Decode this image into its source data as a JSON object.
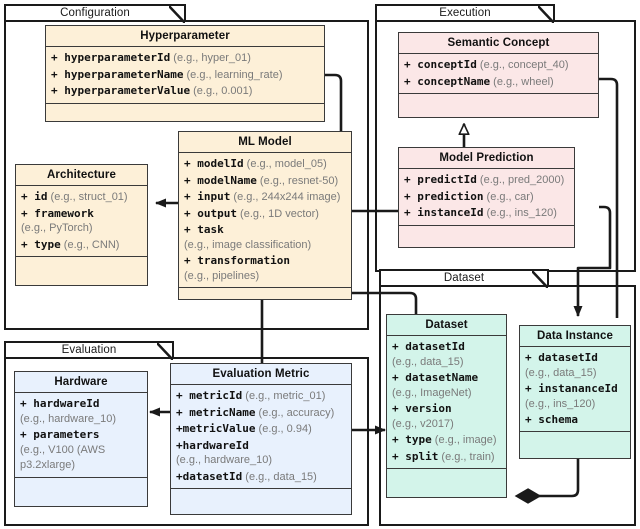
{
  "diagram": {
    "title": "ML Ontology Class Diagram",
    "colors": {
      "yellow": "#fdf0d8",
      "pink": "#fbe7e7",
      "cyan": "#d3f4ea",
      "blue": "#e8f1fd",
      "border": "#3a3a3a",
      "frame": "#1a1a1a"
    }
  },
  "packages": [
    {
      "id": "configuration",
      "label": "Configuration"
    },
    {
      "id": "execution",
      "label": "Execution"
    },
    {
      "id": "dataset",
      "label": "Dataset"
    },
    {
      "id": "evaluation",
      "label": "Evaluation"
    }
  ],
  "classes": {
    "hyperparameter": {
      "title": "Hyperparameter",
      "attributes": [
        {
          "vis": "+ ",
          "name": "hyperparameterId",
          "example": " (e.g., hyper_01)"
        },
        {
          "vis": "+ ",
          "name": "hyperparameterName",
          "example": " (e.g., learning_rate)"
        },
        {
          "vis": "+ ",
          "name": "hyperparameterValue",
          "example": " (e.g., 0.001)"
        }
      ]
    },
    "ml_model": {
      "title": "ML Model",
      "attributes": [
        {
          "vis": "+ ",
          "name": "modelId",
          "example": " (e.g., model_05)"
        },
        {
          "vis": "+ ",
          "name": "modelName",
          "example": " (e.g., resnet-50)"
        },
        {
          "vis": "+ ",
          "name": "input",
          "example": " (e.g., 244x244 image)"
        },
        {
          "vis": "+ ",
          "name": "output",
          "example": " (e.g., 1D vector)"
        },
        {
          "vis": "+ ",
          "name": "task",
          "example": ""
        },
        {
          "cont": "(e.g., image classification)"
        },
        {
          "vis": "+ ",
          "name": "transformation",
          "example": ""
        },
        {
          "cont": "(e.g., pipelines)"
        }
      ]
    },
    "architecture": {
      "title": "Architecture",
      "attributes": [
        {
          "vis": "+ ",
          "name": "id",
          "example": " (e.g., struct_01)"
        },
        {
          "vis": "+ ",
          "name": "framework",
          "example": ""
        },
        {
          "cont": "(e.g., PyTorch)"
        },
        {
          "vis": "+ ",
          "name": "type",
          "example": " (e.g., CNN)"
        }
      ]
    },
    "semantic_concept": {
      "title": "Semantic Concept",
      "attributes": [
        {
          "vis": "+ ",
          "name": "conceptId",
          "example": " (e.g., concept_40)"
        },
        {
          "vis": "+ ",
          "name": "conceptName",
          "example": " (e.g., wheel)"
        }
      ]
    },
    "model_prediction": {
      "title": "Model Prediction",
      "attributes": [
        {
          "vis": "+ ",
          "name": "predictId",
          "example": " (e.g., pred_2000)"
        },
        {
          "vis": "+ ",
          "name": "prediction",
          "example": " (e.g., car)"
        },
        {
          "vis": "+ ",
          "name": "instanceId",
          "example": " (e.g., ins_120)"
        }
      ]
    },
    "dataset": {
      "title": "Dataset",
      "attributes": [
        {
          "vis": "+ ",
          "name": "datasetId",
          "example": ""
        },
        {
          "cont": "(e.g., data_15)"
        },
        {
          "vis": "+ ",
          "name": "datasetName",
          "example": ""
        },
        {
          "cont": "(e.g., ImageNet)"
        },
        {
          "vis": "+ ",
          "name": "version",
          "example": ""
        },
        {
          "cont": "(e.g., v2017)"
        },
        {
          "vis": "+ ",
          "name": "type",
          "example": " (e.g., image)"
        },
        {
          "vis": "+ ",
          "name": "split",
          "example": " (e.g., train)"
        }
      ]
    },
    "data_instance": {
      "title": "Data Instance",
      "attributes": [
        {
          "vis": "+ ",
          "name": "datasetId",
          "example": ""
        },
        {
          "cont": "(e.g., data_15)"
        },
        {
          "vis": "+ ",
          "name": "instananceId",
          "example": ""
        },
        {
          "cont": "(e.g., ins_120)"
        },
        {
          "vis": "+ ",
          "name": "schema",
          "example": ""
        }
      ]
    },
    "hardware": {
      "title": "Hardware",
      "attributes": [
        {
          "vis": "+ ",
          "name": "hardwareId",
          "example": ""
        },
        {
          "cont": "(e.g., hardware_10)"
        },
        {
          "vis": "+ ",
          "name": "parameters",
          "example": ""
        },
        {
          "cont": "(e.g., V100 (AWS"
        },
        {
          "cont": "p3.2xlarge)"
        }
      ]
    },
    "evaluation_metric": {
      "title": "Evaluation Metric",
      "attributes": [
        {
          "vis": "+ ",
          "name": "metricId",
          "example": " (e.g., metric_01)"
        },
        {
          "vis": "+ ",
          "name": "metricName",
          "example": " (e.g., accuracy)"
        },
        {
          "vis": "+",
          "name": "metricValue",
          "example": " (e.g., 0.94)"
        },
        {
          "vis": "+",
          "name": "hardwareId",
          "example": ""
        },
        {
          "cont": "(e.g., hardware_10)"
        },
        {
          "vis": "+",
          "name": "datasetId",
          "example": " (e.g., data_15)"
        }
      ]
    }
  }
}
